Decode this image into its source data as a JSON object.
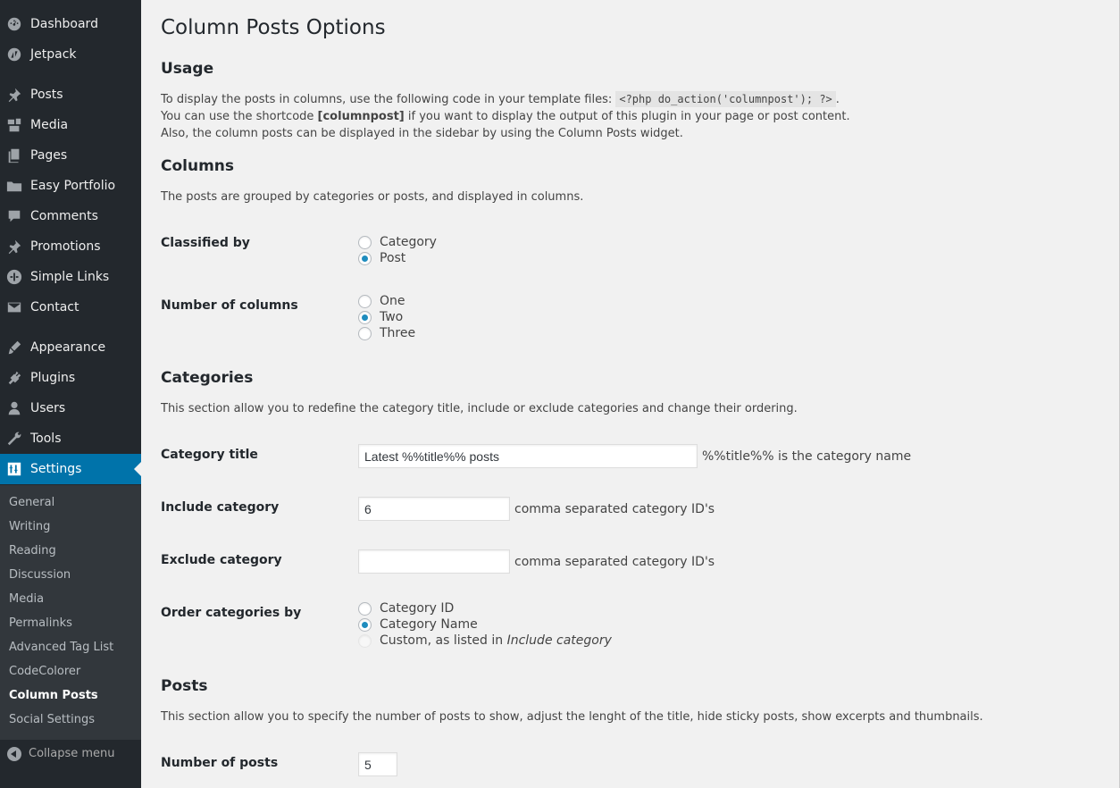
{
  "sidebar": {
    "items": [
      {
        "label": "Dashboard",
        "icon": "dashboard-icon"
      },
      {
        "label": "Jetpack",
        "icon": "jetpack-icon"
      },
      {
        "label": "Posts",
        "icon": "pin-icon"
      },
      {
        "label": "Media",
        "icon": "media-icon"
      },
      {
        "label": "Pages",
        "icon": "pages-icon"
      },
      {
        "label": "Easy Portfolio",
        "icon": "folder-icon"
      },
      {
        "label": "Comments",
        "icon": "comment-icon"
      },
      {
        "label": "Promotions",
        "icon": "pin-icon"
      },
      {
        "label": "Simple Links",
        "icon": "links-icon"
      },
      {
        "label": "Contact",
        "icon": "envelope-icon"
      },
      {
        "label": "Appearance",
        "icon": "brush-icon"
      },
      {
        "label": "Plugins",
        "icon": "plug-icon"
      },
      {
        "label": "Users",
        "icon": "user-icon"
      },
      {
        "label": "Tools",
        "icon": "wrench-icon"
      },
      {
        "label": "Settings",
        "icon": "settings-icon"
      }
    ],
    "submenu": [
      "General",
      "Writing",
      "Reading",
      "Discussion",
      "Media",
      "Permalinks",
      "Advanced Tag List",
      "CodeColorer",
      "Column Posts",
      "Social Settings"
    ],
    "collapse_label": "Collapse menu"
  },
  "page": {
    "title": "Column Posts Options",
    "usage": {
      "heading": "Usage",
      "line1_pre": "To display the posts in columns, use the following code in your template files:",
      "line1_code": "<?php do_action('columnpost'); ?>",
      "line1_post": ".",
      "line2_pre": "You can use the shortcode ",
      "line2_bold": "[columnpost]",
      "line2_post": " if you want to display the output of this plugin in your page or post content.",
      "line3": "Also, the column posts can be displayed in the sidebar by using the Column Posts widget."
    },
    "columns": {
      "heading": "Columns",
      "desc": "The posts are grouped by categories or posts, and displayed in columns.",
      "classified_label": "Classified by",
      "classified_options": [
        "Category",
        "Post"
      ],
      "classified_selected": "Post",
      "number_label": "Number of columns",
      "number_options": [
        "One",
        "Two",
        "Three"
      ],
      "number_selected": "Two"
    },
    "categories": {
      "heading": "Categories",
      "desc": "This section allow you to redefine the category title, include or exclude categories and change their ordering.",
      "title_label": "Category title",
      "title_value": "Latest %%title%% posts",
      "title_hint": "%%title%% is the category name",
      "include_label": "Include category",
      "include_value": "6",
      "include_hint": "comma separated category ID's",
      "exclude_label": "Exclude category",
      "exclude_value": "",
      "exclude_hint": "comma separated category ID's",
      "order_label": "Order categories by",
      "order_options": [
        "Category ID",
        "Category Name"
      ],
      "order_custom_pre": "Custom, as listed in ",
      "order_custom_em": "Include category",
      "order_selected": "Category Name"
    },
    "posts": {
      "heading": "Posts",
      "desc": "This section allow you to specify the number of posts to show, adjust the lenght of the title, hide sticky posts, show excerpts and thumbnails.",
      "number_label": "Number of posts",
      "number_value": "5"
    }
  },
  "colors": {
    "sidebar_bg": "#23282d",
    "submenu_bg": "#32373c",
    "accent": "#0073aa",
    "radio_checked": "#1e8cbe",
    "content_bg": "#f1f1f1"
  }
}
